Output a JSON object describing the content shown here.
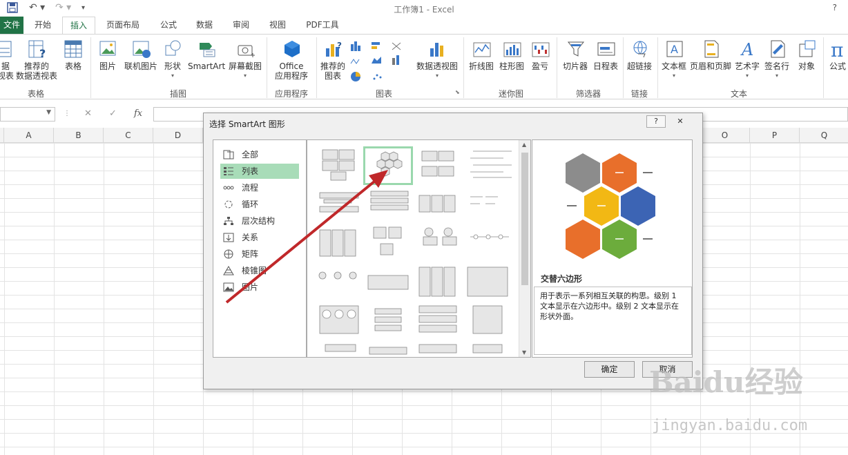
{
  "window": {
    "title": "工作簿1 - Excel",
    "help": "?"
  },
  "tabs": [
    "文件",
    "开始",
    "插入",
    "页面布局",
    "公式",
    "数据",
    "审阅",
    "视图",
    "PDF工具"
  ],
  "active_tab": "插入",
  "ribbon": {
    "groups": [
      "表格",
      "插图",
      "应用程序",
      "图表",
      "迷你图",
      "筛选器",
      "链接",
      "文本"
    ],
    "buttons": {
      "pivot_cut": "据\n视表",
      "rec_pivot": "推荐的\n数据透视表",
      "table": "表格",
      "picture": "图片",
      "online_picture": "联机图片",
      "shapes": "形状",
      "smartart": "SmartArt",
      "screenshot": "屏幕截图",
      "office_apps": "Office\n应用程序",
      "rec_charts": "推荐的\n图表",
      "pivot_chart": "数据透视图",
      "line": "折线图",
      "column": "柱形图",
      "winloss": "盈亏",
      "slicer": "切片器",
      "timeline": "日程表",
      "hyperlink": "超链接",
      "textbox": "文本框",
      "header_footer": "页眉和页脚",
      "wordart": "艺术字",
      "signature": "签名行",
      "object": "对象",
      "equation": "公式"
    }
  },
  "formula_bar": {
    "fx": "fx",
    "cancel": "✕",
    "enter": "✓"
  },
  "columns": [
    "A",
    "B",
    "C",
    "D",
    "O",
    "P",
    "Q"
  ],
  "dialog": {
    "title": "选择 SmartArt 图形",
    "help_btn": "?",
    "close_btn": "✕",
    "categories": [
      "全部",
      "列表",
      "流程",
      "循环",
      "层次结构",
      "关系",
      "矩阵",
      "棱锥图",
      "图片"
    ],
    "selected_category": "列表",
    "preview_name": "交替六边形",
    "preview_desc": "用于表示一系列相互关联的构思。级别 1 文本显示在六边形中。级别 2 文本显示在形状外面。",
    "ok": "确定",
    "cancel": "取消"
  },
  "colors": {
    "excel_green": "#217346",
    "arrow": "#c0282a",
    "hex_gray": "#8c8c8c",
    "hex_orange": "#e86f2b",
    "hex_yellow": "#f2b814",
    "hex_blue": "#3c64b4",
    "hex_green": "#6cac3c"
  },
  "watermark": {
    "brand": "Baidu经验",
    "url": "jingyan.baidu.com"
  }
}
